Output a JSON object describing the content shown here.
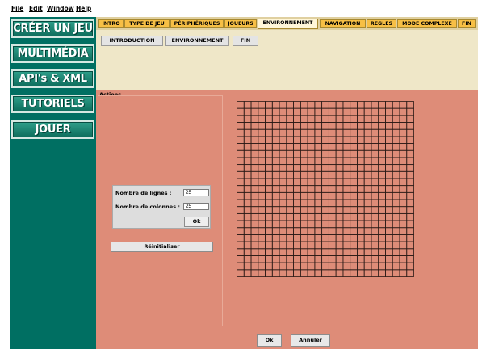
{
  "menu": [
    "File",
    "Edit",
    "Window",
    "Help"
  ],
  "sidebar": {
    "buttons": [
      "CRÉER UN JEU",
      "MULTIMÉDIA",
      "API's & XML",
      "TUTORIELS",
      "JOUER"
    ]
  },
  "tabs": {
    "items": [
      "INTRO",
      "TYPE DE JEU",
      "PÉRIPHÉRIQUES",
      "JOUEURS",
      "ENVIRONNEMENT",
      "NAVIGATION",
      "REGLES",
      "MODE COMPLEXE",
      "FIN"
    ],
    "active": "ENVIRONNEMENT"
  },
  "subtabs": [
    "INTRODUCTION",
    "ENVIRONNEMENT",
    "FIN"
  ],
  "actions": {
    "title": "Actions",
    "rows_label": "Nombre de lignes :",
    "rows_value": "25",
    "cols_label": "Nombre de colonnes :",
    "cols_value": "25",
    "ok_label": "Ok",
    "reset_label": "Réinitialiser"
  },
  "grid": {
    "rows": 25,
    "cols": 25
  },
  "footer": {
    "ok_label": "Ok",
    "cancel_label": "Annuler"
  },
  "colors": {
    "sidebar": "#006f62",
    "tab": "#f7bf45",
    "panel": "#efe7c8",
    "content": "#de8c78"
  }
}
